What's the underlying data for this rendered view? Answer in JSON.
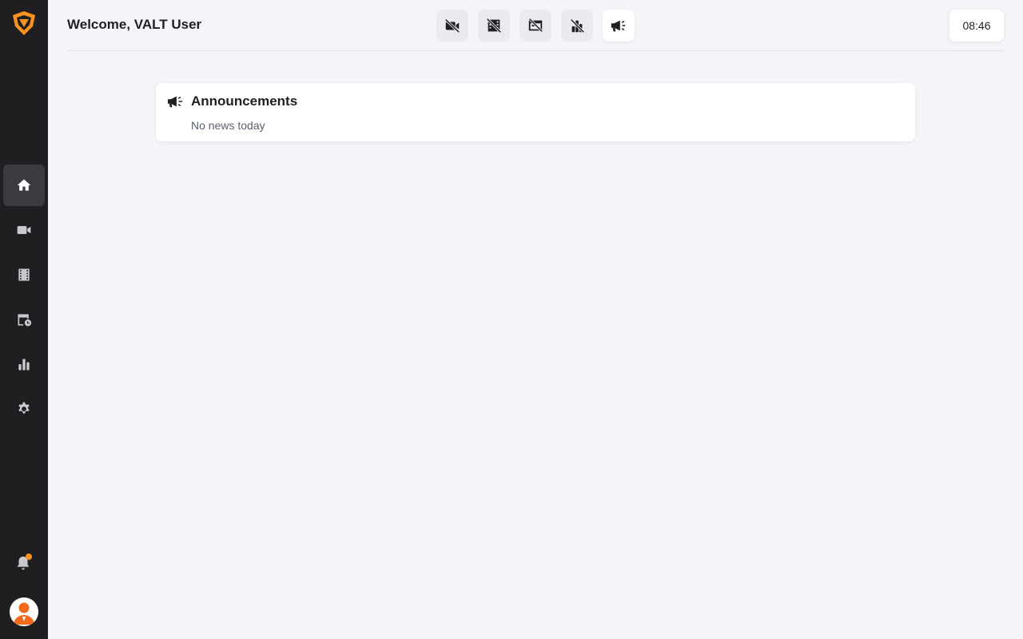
{
  "header": {
    "welcome": "Welcome, VALT User",
    "clock": "08:46"
  },
  "toolbar": {
    "buttons": [
      {
        "icon": "camera-off-icon"
      },
      {
        "icon": "film-off-icon"
      },
      {
        "icon": "schedule-off-icon"
      },
      {
        "icon": "stats-off-icon"
      },
      {
        "icon": "megaphone-icon",
        "active": true
      }
    ]
  },
  "sidebar": {
    "items": [
      {
        "icon": "home-icon",
        "active": true
      },
      {
        "icon": "video-camera-icon"
      },
      {
        "icon": "film-icon"
      },
      {
        "icon": "schedule-icon"
      },
      {
        "icon": "bar-chart-icon"
      },
      {
        "icon": "gear-icon"
      }
    ],
    "notification_indicator": true
  },
  "announcements": {
    "title": "Announcements",
    "message": "No news today"
  },
  "colors": {
    "sidebar_bg": "#1f1f22",
    "page_bg": "#f3f5f9",
    "accent": "#f7931e"
  }
}
